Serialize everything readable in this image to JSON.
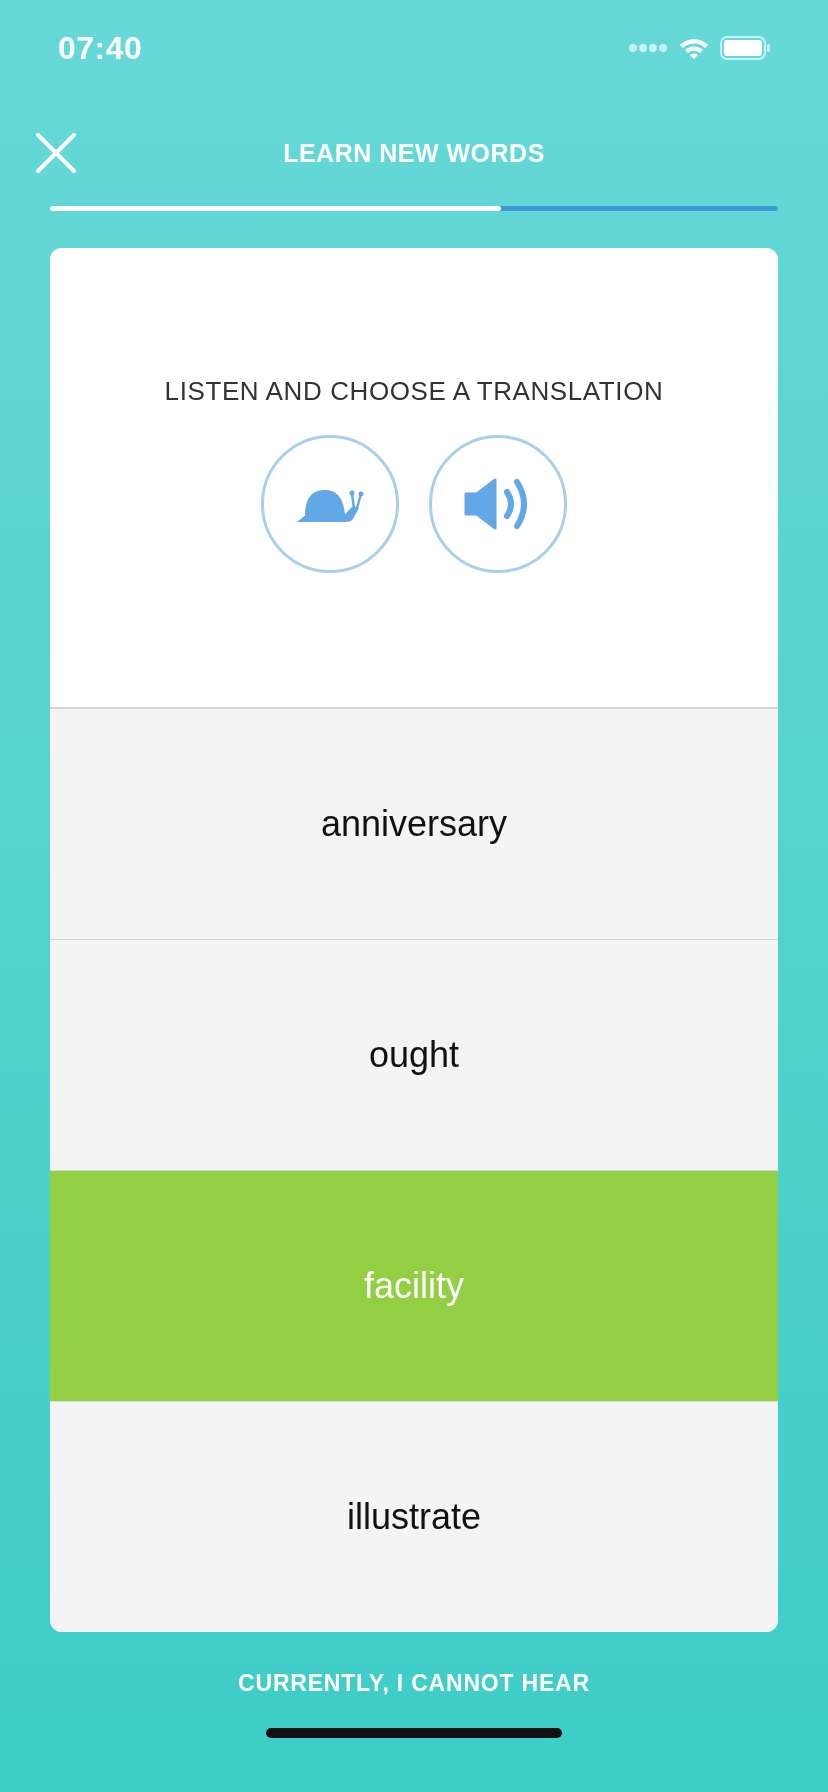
{
  "status_bar": {
    "time": "07:40"
  },
  "header": {
    "title": "LEARN NEW WORDS"
  },
  "progress": {
    "level": 0.62
  },
  "exercise": {
    "instruction": "LISTEN AND CHOOSE A TRANSLATION"
  },
  "options": [
    {
      "label": "anniversary",
      "selected": false
    },
    {
      "label": "ought",
      "selected": false
    },
    {
      "label": "facility",
      "selected": true
    },
    {
      "label": "illustrate",
      "selected": false
    }
  ],
  "footer": {
    "link": "CURRENTLY, I CANNOT HEAR"
  }
}
